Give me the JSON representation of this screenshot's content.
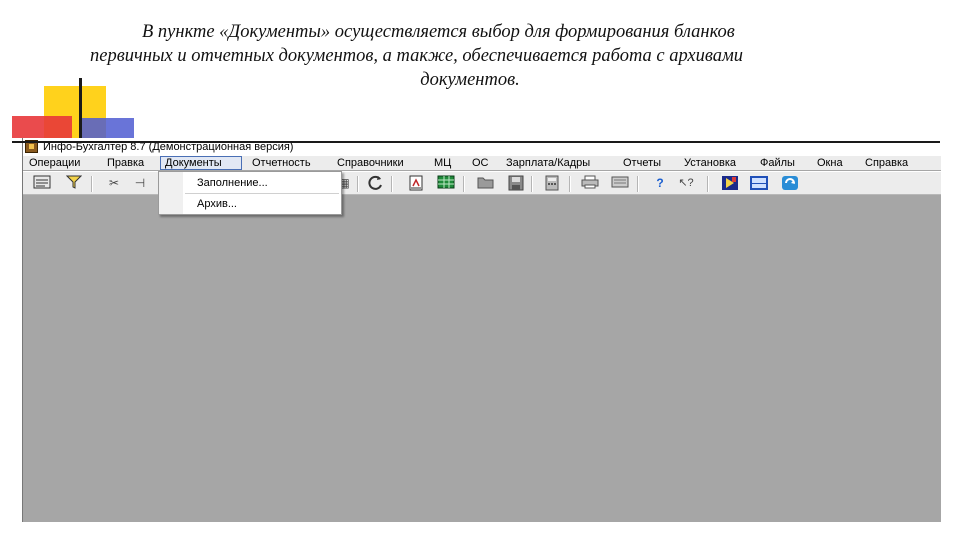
{
  "slide": {
    "line1": "В пункте «Документы» осуществляется выбор для формирования бланков",
    "line2": "первичных и отчетных документов, а также, обеспечивается работа с архивами",
    "line3": "документов."
  },
  "window": {
    "title": "Инфо-Бухгалтер 8.7 (Демонстрационная версия)"
  },
  "menu": {
    "items": [
      "Операции",
      "Правка",
      "Документы",
      "Отчетность",
      "Справочники",
      "МЦ",
      "ОС",
      "Зарплата/Кадры",
      "Отчеты",
      "Установка",
      "Файлы",
      "Окна",
      "Справка"
    ],
    "active": "Документы"
  },
  "dropdown": {
    "items": [
      "Заполнение...",
      "Архив..."
    ]
  },
  "toolbar": {
    "icons": [
      "form-icon",
      "filter-icon",
      "cut-icon",
      "link-icon",
      "refresh-icon",
      "report-icon",
      "table-icon",
      "folder-open-icon",
      "save-icon",
      "calculator-icon",
      "printer-icon",
      "print-preview-icon",
      "help-icon",
      "context-help-icon",
      "bookmark-icon",
      "calendar-icon",
      "update-icon"
    ]
  },
  "colors": {
    "workspace": "#a6a6a6",
    "menubar": "#ececec",
    "accent_yellow": "#ffd21c",
    "accent_blue": "#4f5cd1",
    "accent_red": "#e8373a"
  }
}
